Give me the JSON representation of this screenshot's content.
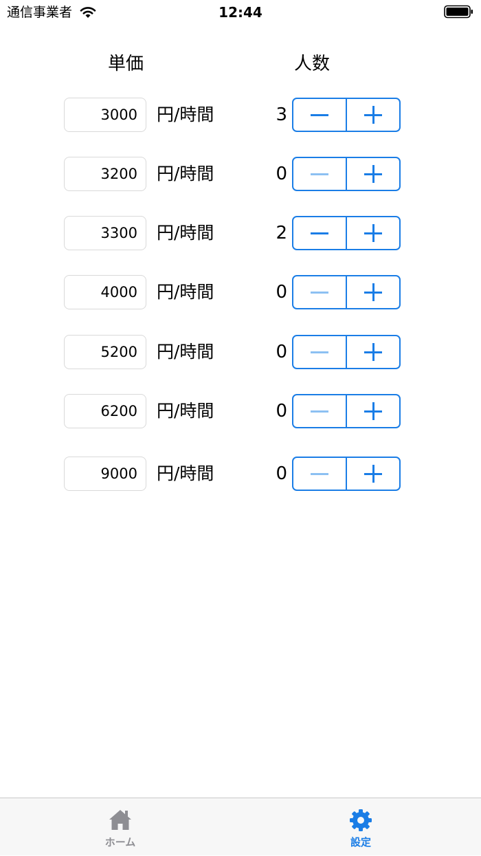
{
  "status_bar": {
    "carrier": "通信事業者",
    "time": "12:44"
  },
  "headers": {
    "price": "単価",
    "count": "人数"
  },
  "rows": [
    {
      "price": "3000",
      "unit": "円/時間",
      "count": "3",
      "minus_enabled": true
    },
    {
      "price": "3200",
      "unit": "円/時間",
      "count": "0",
      "minus_enabled": false
    },
    {
      "price": "3300",
      "unit": "円/時間",
      "count": "2",
      "minus_enabled": true
    },
    {
      "price": "4000",
      "unit": "円/時間",
      "count": "0",
      "minus_enabled": false
    },
    {
      "price": "5200",
      "unit": "円/時間",
      "count": "0",
      "minus_enabled": false
    },
    {
      "price": "6200",
      "unit": "円/時間",
      "count": "0",
      "minus_enabled": false
    },
    {
      "price": "9000",
      "unit": "円/時間",
      "count": "0",
      "minus_enabled": false
    }
  ],
  "tab_bar": {
    "home_label": "ホーム",
    "home_icon": "house-icon",
    "settings_label": "設定",
    "settings_icon": "gear-icon",
    "selected": "settings"
  },
  "colors": {
    "accent": "#1a7de6",
    "disabled_accent": "#8cc0f2",
    "inactive_tab": "#8e8e93"
  }
}
